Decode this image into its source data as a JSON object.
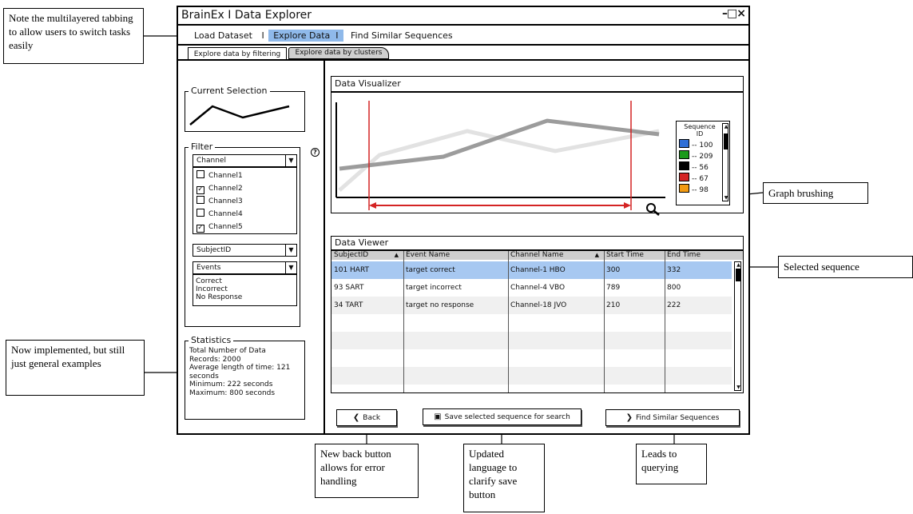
{
  "window": {
    "title": "BrainEx I Data Explorer",
    "controls": "–□×"
  },
  "main_tabs": [
    {
      "label": "Load Dataset"
    },
    {
      "label": "Explore Data"
    },
    {
      "label": "Find Similar Sequences"
    }
  ],
  "tab_sep": "I",
  "sub_tabs": [
    {
      "label": "Explore data by filtering"
    },
    {
      "label": "Explore data by clusters"
    }
  ],
  "current_selection": {
    "title": "Current Selection"
  },
  "filter": {
    "title": "Filter",
    "help_icon": "?",
    "channel_dropdown": "Channel",
    "channels": [
      {
        "label": "Channel1",
        "checked": false
      },
      {
        "label": "Channel2",
        "checked": true
      },
      {
        "label": "Channel3",
        "checked": false
      },
      {
        "label": "Channel4",
        "checked": false
      },
      {
        "label": "Channel5",
        "checked": true
      }
    ],
    "subject_dropdown": "SubjectID",
    "events_dropdown": "Events",
    "events": [
      "Correct",
      "Incorrect",
      "No Response"
    ]
  },
  "statistics": {
    "title": "Statistics",
    "lines": [
      "Total Number of Data",
      "Records: 2000",
      "Average length of time: 121",
      "seconds",
      "Minimum: 222 seconds",
      "Maximum: 800 seconds"
    ]
  },
  "visualizer": {
    "title": "Data Visualizer",
    "legend_title_1": "Sequence",
    "legend_title_2": "ID",
    "legend": [
      {
        "label": "-- 100",
        "color": "#2f6fd6"
      },
      {
        "label": "-- 209",
        "color": "#1a9a1a"
      },
      {
        "label": "-- 56",
        "color": "#000000"
      },
      {
        "label": "-- 67",
        "color": "#d42424"
      },
      {
        "label": "-- 98",
        "color": "#f29a12"
      }
    ]
  },
  "viewer": {
    "title": "Data Viewer",
    "columns": [
      "SubjectID",
      "Event Name",
      "Channel Name",
      "Start Time",
      "End Time"
    ],
    "rows": [
      [
        "101 HART",
        "target correct",
        "Channel-1 HBO",
        "300",
        "332"
      ],
      [
        "93 SART",
        "target incorrect",
        "Channel-4 VBO",
        "789",
        "800"
      ],
      [
        "34 TART",
        "target no response",
        "Channel-18 JVO",
        "210",
        "222"
      ]
    ],
    "selected_row": 0
  },
  "buttons": {
    "back": "Back",
    "save": "Save selected sequence for search",
    "find": "Find Similar Sequences"
  },
  "annotations": {
    "tabbing": "Note the multilayered tabbing to allow users to switch tasks easily",
    "brushing": "Graph brushing",
    "selected": "Selected sequence",
    "stats": "Now implemented, but still just general examples",
    "back": "New back button allows for error handling",
    "save": "Updated language to clarify save button",
    "find": "Leads to querying"
  }
}
